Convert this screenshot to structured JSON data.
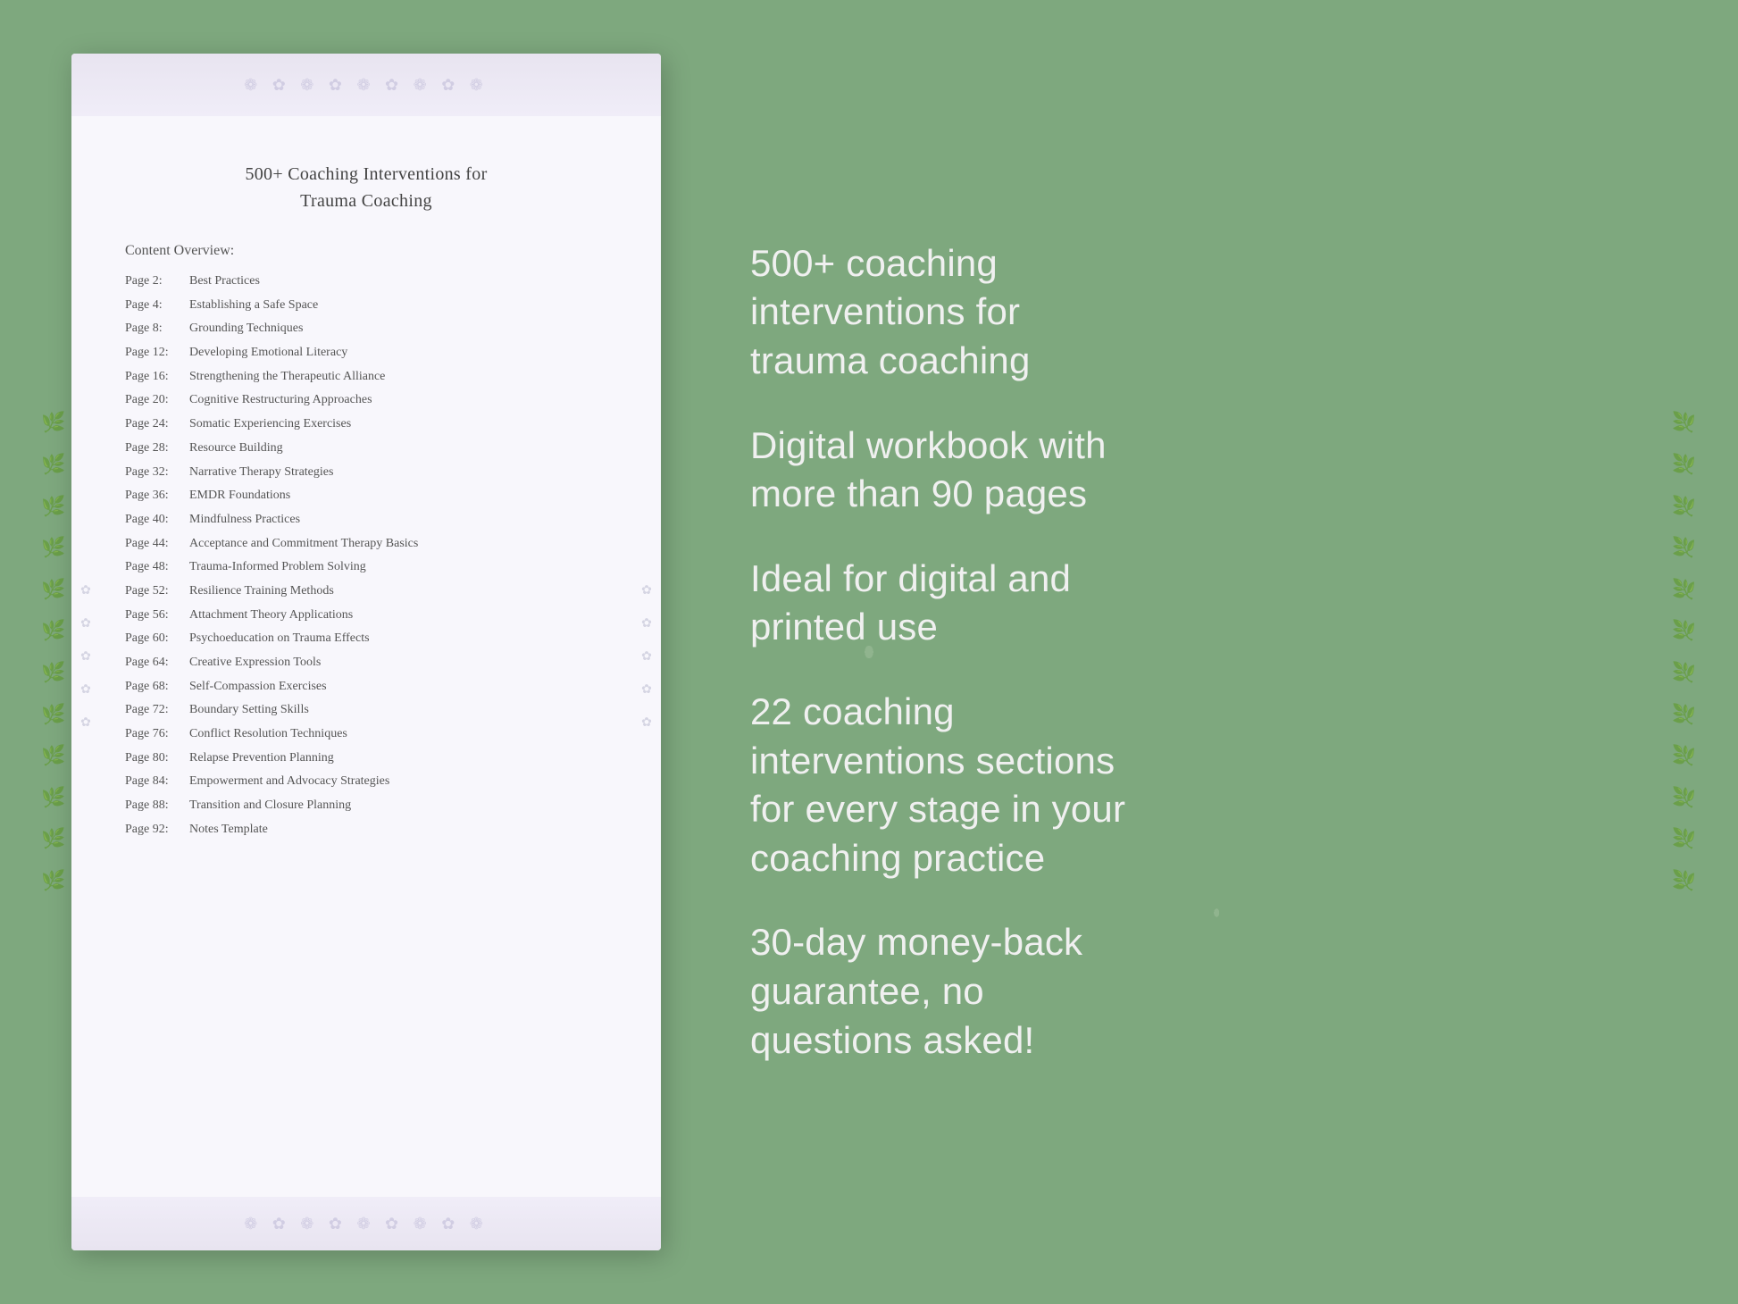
{
  "background": {
    "color": "#7ea87e"
  },
  "document": {
    "title_line1": "500+ Coaching Interventions for",
    "title_line2": "Trauma Coaching",
    "content_overview_label": "Content Overview:",
    "toc": [
      {
        "page": "Page  2:",
        "title": "Best Practices"
      },
      {
        "page": "Page  4:",
        "title": "Establishing a Safe Space"
      },
      {
        "page": "Page  8:",
        "title": "Grounding Techniques"
      },
      {
        "page": "Page 12:",
        "title": "Developing Emotional Literacy"
      },
      {
        "page": "Page 16:",
        "title": "Strengthening the Therapeutic Alliance"
      },
      {
        "page": "Page 20:",
        "title": "Cognitive Restructuring Approaches"
      },
      {
        "page": "Page 24:",
        "title": "Somatic Experiencing Exercises"
      },
      {
        "page": "Page 28:",
        "title": "Resource Building"
      },
      {
        "page": "Page 32:",
        "title": "Narrative Therapy Strategies"
      },
      {
        "page": "Page 36:",
        "title": "EMDR Foundations"
      },
      {
        "page": "Page 40:",
        "title": "Mindfulness Practices"
      },
      {
        "page": "Page 44:",
        "title": "Acceptance and Commitment Therapy Basics"
      },
      {
        "page": "Page 48:",
        "title": "Trauma-Informed Problem Solving"
      },
      {
        "page": "Page 52:",
        "title": "Resilience Training Methods"
      },
      {
        "page": "Page 56:",
        "title": "Attachment Theory Applications"
      },
      {
        "page": "Page 60:",
        "title": "Psychoeducation on Trauma Effects"
      },
      {
        "page": "Page 64:",
        "title": "Creative Expression Tools"
      },
      {
        "page": "Page 68:",
        "title": "Self-Compassion Exercises"
      },
      {
        "page": "Page 72:",
        "title": "Boundary Setting Skills"
      },
      {
        "page": "Page 76:",
        "title": "Conflict Resolution Techniques"
      },
      {
        "page": "Page 80:",
        "title": "Relapse Prevention Planning"
      },
      {
        "page": "Page 84:",
        "title": "Empowerment and Advocacy Strategies"
      },
      {
        "page": "Page 88:",
        "title": "Transition and Closure Planning"
      },
      {
        "page": "Page 92:",
        "title": "Notes Template"
      }
    ]
  },
  "info_panel": {
    "block1": "500+ coaching\ninterventions for\ntrauma coaching",
    "block2": "Digital workbook with\nmore than 90 pages",
    "block3": "Ideal for digital and\nprinted use",
    "block4": "22 coaching\ninterventions sections\nfor every stage in your\ncoaching practice",
    "block5": "30-day money-back\nguarantee, no\nquestions asked!"
  }
}
